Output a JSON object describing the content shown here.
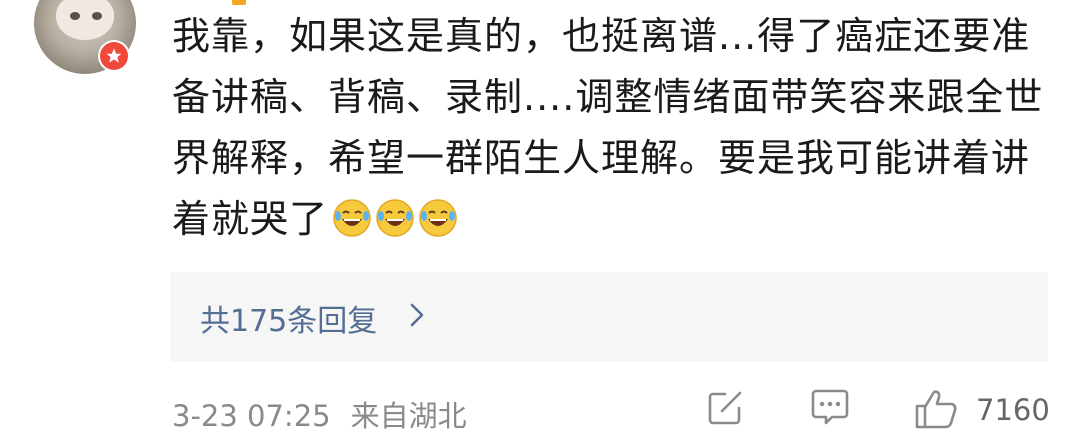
{
  "comment": {
    "text": "我靠，如果这是真的，也挺离谱...得了癌症还要准备讲稿、背稿、录制....调整情绪面带笑容来跟全世界解释，希望一群陌生人理解。要是我可能讲着讲着就哭了",
    "emojis": [
      "laughing-crying-emoji",
      "laughing-crying-emoji",
      "laughing-crying-emoji"
    ]
  },
  "replies": {
    "label": "共175条回复"
  },
  "meta": {
    "date": "3-23 07:25",
    "location": "来自湖北"
  },
  "actions": {
    "share_icon": "share-icon",
    "comment_icon": "comment-icon",
    "like_icon": "thumbs-up-icon",
    "likes": "7160"
  },
  "colors": {
    "reply_link": "#536d94",
    "badge": "#f0483a",
    "meta_text": "#8a8a8a",
    "panel_bg": "#f6f6f6"
  }
}
